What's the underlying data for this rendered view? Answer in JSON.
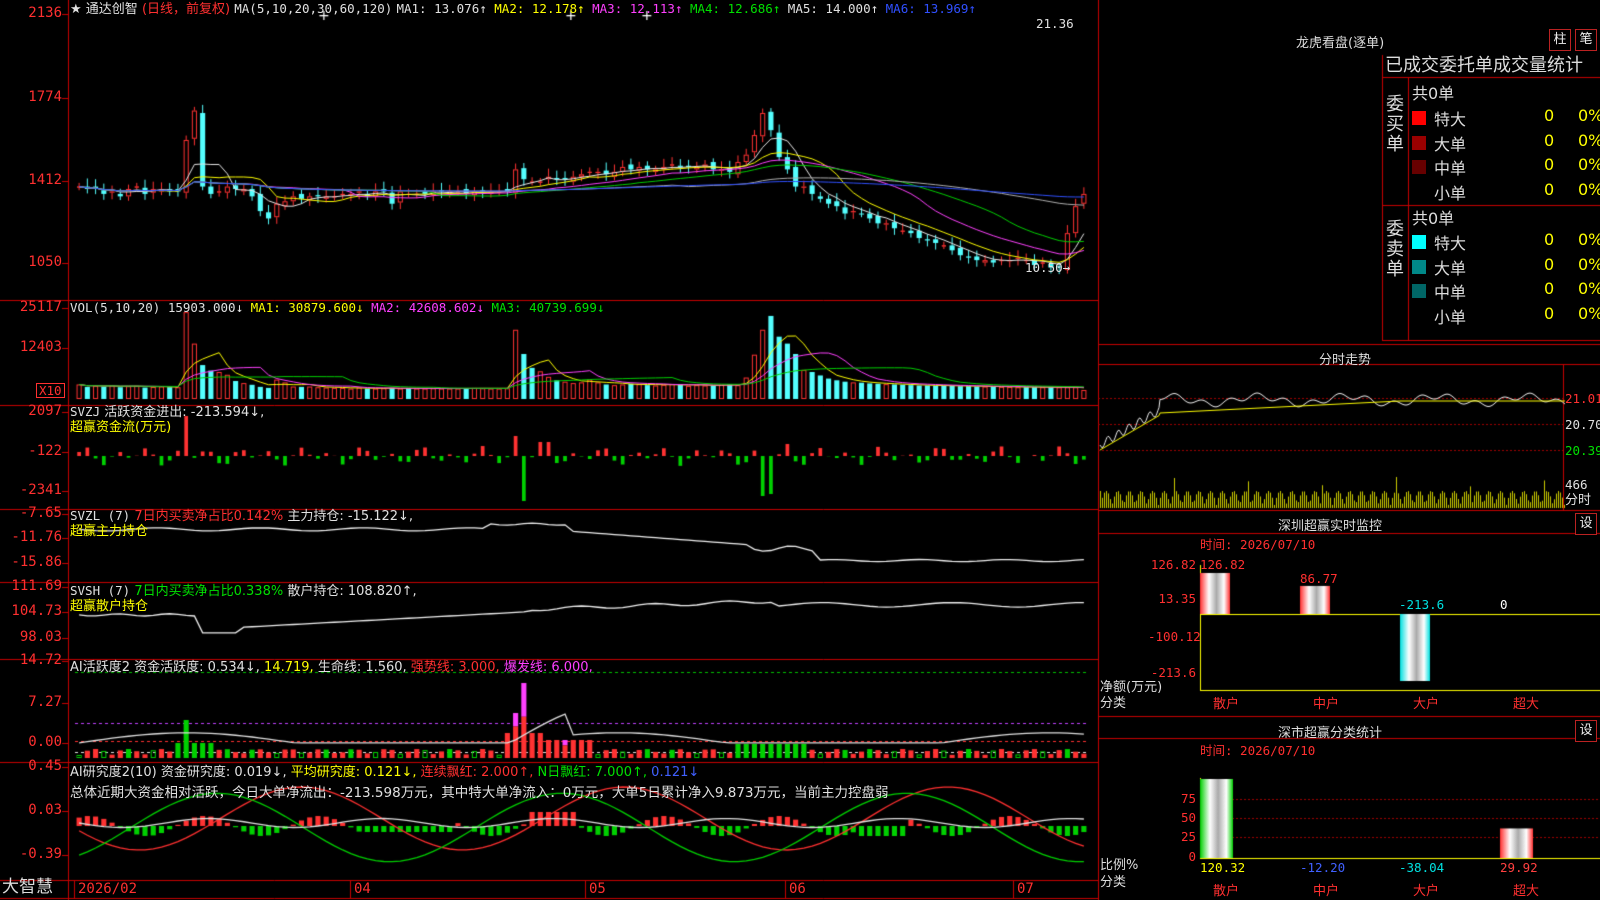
{
  "app": {
    "logo": "大智慧"
  },
  "main": {
    "star": "★",
    "stock_name": "通达创智",
    "period": "(日线，前复权)",
    "ma_label": "MA(5,10,20,30,60,120)",
    "ma": [
      {
        "label": "MA1:",
        "value": "13.076",
        "arrow": "↑",
        "color": "#e0e0e0"
      },
      {
        "label": "MA2:",
        "value": "12.178",
        "arrow": "↑",
        "color": "#ffff00"
      },
      {
        "label": "MA3:",
        "value": "12.113",
        "arrow": "↑",
        "color": "#ff40ff"
      },
      {
        "label": "MA4:",
        "value": "12.686",
        "arrow": "↑",
        "color": "#00e000"
      },
      {
        "label": "MA5:",
        "value": "14.000",
        "arrow": "↑",
        "color": "#e0e0e0"
      },
      {
        "label": "MA6:",
        "value": "13.969",
        "arrow": "↑",
        "color": "#3050ff"
      }
    ],
    "yticks": [
      "2136",
      "1774",
      "1412",
      "1050"
    ],
    "hi_label": "21.36",
    "lo_label": "10.50"
  },
  "vol": {
    "label": "VOL(5,10,20)",
    "value": "15903.000↓",
    "ma1": "MA1: 30879.600↓",
    "ma2": "MA2: 42608.602↓",
    "ma3": "MA3: 40739.699↓",
    "yticks": [
      "25117",
      "12403"
    ],
    "unit": "X10"
  },
  "svzj": {
    "label": "SVZJ",
    "desc": "活跃资金进出: -213.594↓,",
    "sub": "超赢资金流(万元)",
    "yticks": [
      "2097",
      "-122",
      "-2341"
    ]
  },
  "svzl": {
    "label": "SVZL (7)",
    "ratio": "7日内买卖净占比0.142%",
    "main": "主力持仓: -15.122↓,",
    "sub": "超赢主力持仓",
    "yticks": [
      "-7.65",
      "-11.76",
      "-15.86"
    ]
  },
  "svsh": {
    "label": "SVSH (7)",
    "ratio": "7日内买卖净占比0.338%",
    "main": "散户持仓: 108.820↑,",
    "sub": "超赢散户持仓",
    "yticks": [
      "111.69",
      "104.73",
      "98.03"
    ]
  },
  "ai1": {
    "label": "AI活跃度2",
    "a": "资金活跃度: 0.534↓,",
    "b": "14.719,",
    "c": "生命线: 1.560,",
    "d": "强势线: 3.000,",
    "e": "爆发线: 6.000,",
    "yticks": [
      "14.72",
      "7.27",
      "0.00"
    ]
  },
  "ai2": {
    "label": "AI研究度2(10)",
    "a": "资金研究度: 0.019↓,",
    "b": "平均研究度: 0.121↓,",
    "c": "连续飘红: 2.000↑,",
    "d": "N日飘红: 7.000↑,",
    "e": "0.121↓",
    "summary": "总体近期大资金相对活跃，今日大单净流出：-213.598万元，其中特大单净流入：0万元，大单5日累计净入9.873万元，当前主力控盘弱",
    "yticks": [
      "0.45",
      "0.03",
      "-0.39"
    ]
  },
  "xaxis": {
    "labels": [
      "2026/02",
      "04",
      "05",
      "06",
      "07"
    ]
  },
  "lhb": {
    "title": "龙虎看盘(逐单)",
    "btn1": "柱",
    "btn2": "笔",
    "subtitle": "已成交委托单成交量统计",
    "buy": {
      "side": "委买单",
      "total": "共0单",
      "rows": [
        {
          "label": "特大",
          "val": "0",
          "pct": "0%",
          "color": "#ff0000"
        },
        {
          "label": "大单",
          "val": "0",
          "pct": "0%",
          "color": "#990000"
        },
        {
          "label": "中单",
          "val": "0",
          "pct": "0%",
          "color": "#660000"
        },
        {
          "label": "小单",
          "val": "0",
          "pct": "0%",
          "color": ""
        }
      ]
    },
    "sell": {
      "side": "委卖单",
      "total": "共0单",
      "rows": [
        {
          "label": "特大",
          "val": "0",
          "pct": "0%",
          "color": "#00ffff"
        },
        {
          "label": "大单",
          "val": "0",
          "pct": "0%",
          "color": "#008888"
        },
        {
          "label": "中单",
          "val": "0",
          "pct": "0%",
          "color": "#006666"
        },
        {
          "label": "小单",
          "val": "0",
          "pct": "0%",
          "color": ""
        }
      ]
    }
  },
  "fenshi": {
    "title": "分时走势",
    "yticks": [
      "21.01",
      "20.70",
      "20.39"
    ],
    "vol_label": "466",
    "unit": "分时"
  },
  "monitor": {
    "title": "深圳超赢实时监控",
    "btn": "设",
    "time": "时间: 2026/07/10",
    "yticks": [
      "126.82",
      "13.35",
      "-100.12",
      "-213.6"
    ],
    "bars": [
      {
        "cat": "散户",
        "value": 126.82,
        "label": "126.82"
      },
      {
        "cat": "中户",
        "value": 86.77,
        "label": "86.77"
      },
      {
        "cat": "大户",
        "value": -213.6,
        "label": "-213.6"
      },
      {
        "cat": "超大",
        "value": 0,
        "label": "0"
      }
    ],
    "ylabel": "净额(万元)",
    "xlabel": "分类"
  },
  "classify": {
    "title": "深市超赢分类统计",
    "btn": "设",
    "time": "时间: 2026/07/10",
    "yticks": [
      "75",
      "50",
      "25",
      "0"
    ],
    "bars": [
      {
        "cat": "散户",
        "value": 120.32,
        "label": "120.32",
        "color": "#ffff00"
      },
      {
        "cat": "中户",
        "value": -12.2,
        "label": "-12.20",
        "color": "#4060ff"
      },
      {
        "cat": "大户",
        "value": -38.04,
        "label": "-38.04",
        "color": "#00e0e0"
      },
      {
        "cat": "超大",
        "value": 29.92,
        "label": "29.92",
        "color": "#ff4040"
      }
    ],
    "ylabel": "比例%",
    "xlabel": "分类"
  },
  "chart_data": {
    "type": "candlestick",
    "title": "通达创智 (日线，前复权)",
    "x_month_labels": [
      "2026/02",
      "04",
      "05",
      "06",
      "07"
    ],
    "y_range": [
      10.0,
      21.5
    ],
    "close": [
      14.3,
      14.2,
      14.2,
      14.0,
      14.1,
      13.9,
      14.2,
      14.3,
      14.0,
      14.2,
      14.2,
      14.1,
      14.1,
      16.2,
      17.4,
      14.3,
      14.0,
      14.1,
      14.3,
      14.2,
      14.2,
      13.9,
      13.3,
      13.0,
      13.6,
      13.7,
      13.9,
      13.8,
      13.9,
      13.9,
      13.9,
      13.9,
      14.0,
      14.0,
      14.1,
      13.9,
      14.1,
      14.1,
      13.6,
      14.1,
      14.0,
      14.0,
      14.0,
      14.1,
      14.1,
      14.1,
      14.1,
      14.0,
      14.1,
      14.1,
      14.1,
      14.1,
      14.1,
      15.0,
      14.6,
      14.5,
      14.5,
      14.7,
      14.6,
      14.6,
      14.7,
      14.8,
      14.9,
      14.9,
      14.8,
      14.9,
      15.1,
      15.0,
      15.1,
      15.0,
      15.0,
      15.1,
      15.2,
      15.1,
      15.1,
      15.1,
      15.2,
      15.0,
      15.0,
      14.9,
      15.3,
      15.6,
      16.4,
      17.3,
      16.6,
      15.5,
      15.0,
      14.3,
      14.3,
      14.0,
      13.8,
      13.6,
      13.5,
      13.2,
      13.3,
      13.2,
      13.0,
      12.8,
      12.8,
      12.6,
      12.5,
      12.4,
      12.2,
      12.1,
      12.0,
      11.9,
      11.7,
      11.5,
      11.4,
      11.3,
      11.3,
      11.2,
      11.3,
      11.3,
      11.4,
      11.3,
      11.1,
      11.2,
      11.0,
      11.0,
      12.4,
      13.5,
      14.0
    ],
    "series": [
      {
        "name": "MA1",
        "color": "#e0e0e0"
      },
      {
        "name": "MA2",
        "color": "#ffff00"
      },
      {
        "name": "MA3",
        "color": "#ff40ff"
      },
      {
        "name": "MA4",
        "color": "#00e000"
      },
      {
        "name": "MA5",
        "color": "#e0e0e0"
      },
      {
        "name": "MA6",
        "color": "#3050ff"
      }
    ],
    "volume": [
      4200,
      3500,
      3800,
      3600,
      3900,
      3400,
      3700,
      3800,
      3300,
      3500,
      3600,
      3400,
      3400,
      25117,
      16000,
      9800,
      8200,
      7800,
      7000,
      5200,
      4600,
      4100,
      3500,
      3200,
      5600,
      4800,
      3600,
      3500,
      3600,
      3400,
      3300,
      3200,
      3200,
      3000,
      3300,
      3000,
      3000,
      3100,
      3200,
      3000,
      3100,
      3000,
      3000,
      3100,
      3000,
      3000,
      3000,
      3100,
      3200,
      3100,
      3000,
      3000,
      3100,
      20000,
      13000,
      9000,
      8000,
      6400,
      5400,
      5000,
      4600,
      4800,
      5600,
      4800,
      4200,
      4000,
      4200,
      4400,
      4300,
      4000,
      3900,
      4100,
      4300,
      4200,
      3800,
      4000,
      3900,
      3900,
      4100,
      4300,
      4000,
      6200,
      12800,
      20000,
      24000,
      18000,
      16000,
      13000,
      8400,
      7800,
      6800,
      5900,
      5400,
      5000,
      4800,
      4700,
      4500,
      4400,
      4300,
      4200,
      4100,
      4000,
      3900,
      3900,
      3800,
      3800,
      3800,
      3700,
      3700,
      3600,
      3600,
      3500,
      3500,
      3500,
      3400,
      3400,
      3400,
      3400,
      3400,
      3400,
      3400,
      3400,
      2600
    ]
  }
}
